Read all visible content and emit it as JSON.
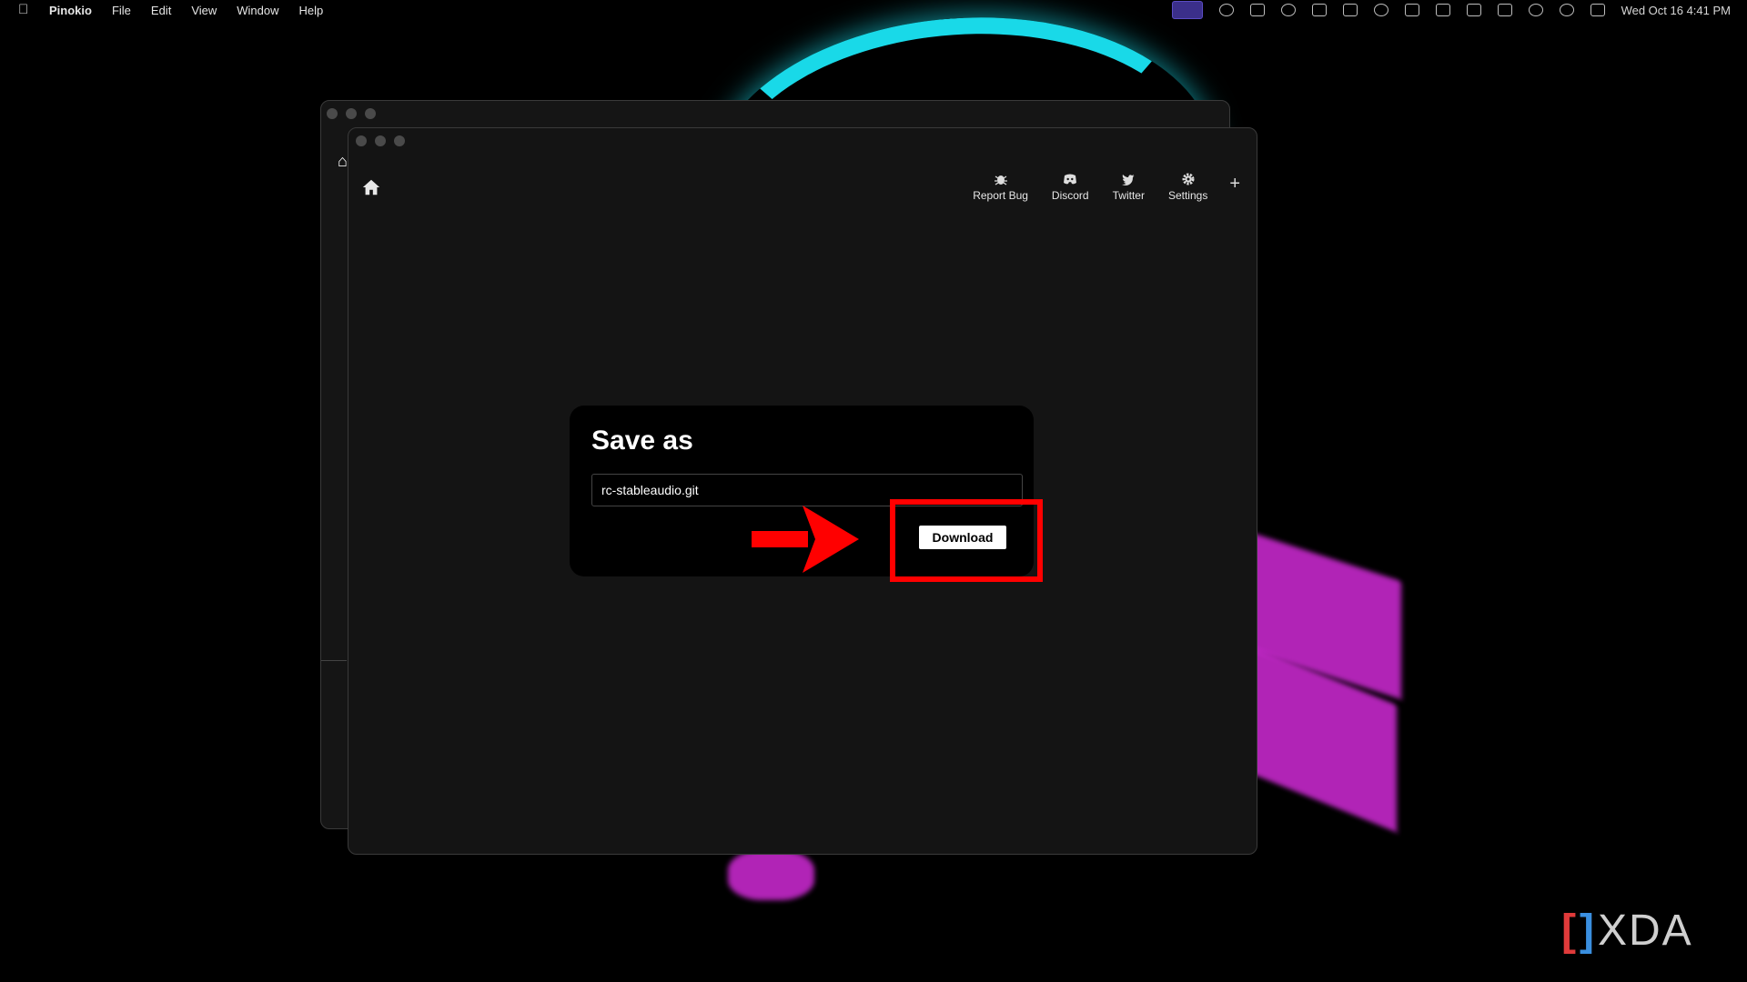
{
  "menubar": {
    "app_name": "Pinokio",
    "items": [
      "File",
      "Edit",
      "View",
      "Window",
      "Help"
    ],
    "clock": "Wed Oct 16  4:41 PM"
  },
  "toolbar": {
    "items": [
      {
        "label": "Report Bug",
        "icon": "bug-icon"
      },
      {
        "label": "Discord",
        "icon": "discord-icon"
      },
      {
        "label": "Twitter",
        "icon": "twitter-icon"
      },
      {
        "label": "Settings",
        "icon": "gear-icon"
      }
    ],
    "plus": "+"
  },
  "dialog": {
    "title": "Save as",
    "filename": "rc-stableaudio.git",
    "download_label": "Download"
  },
  "watermark": {
    "text": "XDA"
  },
  "colors": {
    "highlight": "#ff0000",
    "cyan": "#19d9e8",
    "magenta": "#d02bd6"
  }
}
